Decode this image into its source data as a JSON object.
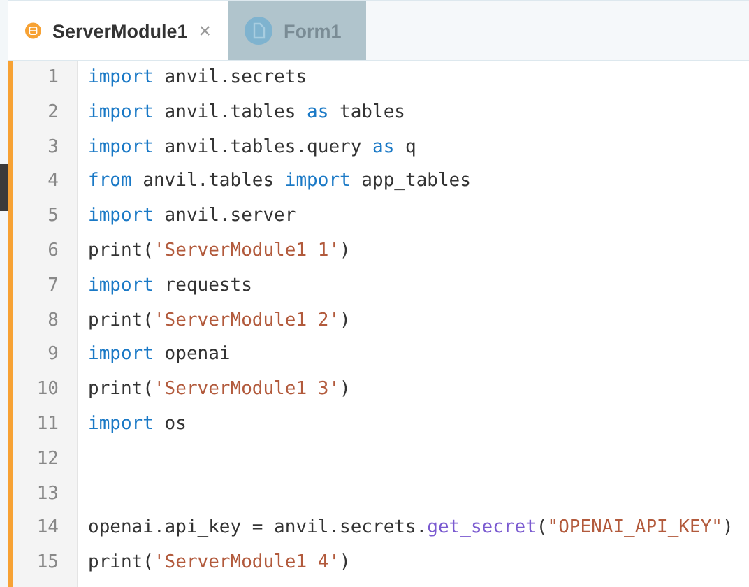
{
  "tabs": [
    {
      "label": "ServerModule1",
      "kind": "server",
      "selected": true,
      "close": "×"
    },
    {
      "label": "Form1",
      "kind": "form",
      "selected": false
    }
  ],
  "editor": {
    "lines": [
      {
        "number": "1",
        "tokens": [
          {
            "kind": "keyword",
            "text": "import"
          },
          {
            "kind": "plain",
            "text": " anvil.secrets"
          }
        ]
      },
      {
        "number": "2",
        "tokens": [
          {
            "kind": "keyword",
            "text": "import"
          },
          {
            "kind": "plain",
            "text": " anvil.tables "
          },
          {
            "kind": "keyword",
            "text": "as"
          },
          {
            "kind": "plain",
            "text": " tables"
          }
        ]
      },
      {
        "number": "3",
        "tokens": [
          {
            "kind": "keyword",
            "text": "import"
          },
          {
            "kind": "plain",
            "text": " anvil.tables.query "
          },
          {
            "kind": "keyword",
            "text": "as"
          },
          {
            "kind": "plain",
            "text": " q"
          }
        ]
      },
      {
        "number": "4",
        "tokens": [
          {
            "kind": "keyword",
            "text": "from"
          },
          {
            "kind": "plain",
            "text": " anvil.tables "
          },
          {
            "kind": "keyword",
            "text": "import"
          },
          {
            "kind": "plain",
            "text": " app_tables"
          }
        ]
      },
      {
        "number": "5",
        "tokens": [
          {
            "kind": "keyword",
            "text": "import"
          },
          {
            "kind": "plain",
            "text": " anvil.server"
          }
        ]
      },
      {
        "number": "6",
        "tokens": [
          {
            "kind": "plain",
            "text": "print("
          },
          {
            "kind": "string",
            "text": "'ServerModule1 1'"
          },
          {
            "kind": "plain",
            "text": ")"
          }
        ]
      },
      {
        "number": "7",
        "tokens": [
          {
            "kind": "keyword",
            "text": "import"
          },
          {
            "kind": "plain",
            "text": " requests"
          }
        ]
      },
      {
        "number": "8",
        "tokens": [
          {
            "kind": "plain",
            "text": "print("
          },
          {
            "kind": "string",
            "text": "'ServerModule1 2'"
          },
          {
            "kind": "plain",
            "text": ")"
          }
        ]
      },
      {
        "number": "9",
        "tokens": [
          {
            "kind": "keyword",
            "text": "import"
          },
          {
            "kind": "plain",
            "text": " openai"
          }
        ]
      },
      {
        "number": "10",
        "tokens": [
          {
            "kind": "plain",
            "text": "print("
          },
          {
            "kind": "string",
            "text": "'ServerModule1 3'"
          },
          {
            "kind": "plain",
            "text": ")"
          }
        ]
      },
      {
        "number": "11",
        "tokens": [
          {
            "kind": "keyword",
            "text": "import"
          },
          {
            "kind": "plain",
            "text": " os"
          }
        ]
      },
      {
        "number": "12"
      },
      {
        "number": "13"
      },
      {
        "number": "14",
        "tokens": [
          {
            "kind": "plain",
            "text": "openai.api_key = anvil.secrets."
          },
          {
            "kind": "function",
            "text": "get_secret"
          },
          {
            "kind": "plain",
            "text": "("
          },
          {
            "kind": "string",
            "text": "\"OPENAI_API_KEY\""
          },
          {
            "kind": "plain",
            "text": ")"
          }
        ]
      },
      {
        "number": "15",
        "tokens": [
          {
            "kind": "plain",
            "text": "print("
          },
          {
            "kind": "string",
            "text": "'ServerModule1 4'"
          },
          {
            "kind": "plain",
            "text": ")"
          }
        ]
      }
    ]
  }
}
